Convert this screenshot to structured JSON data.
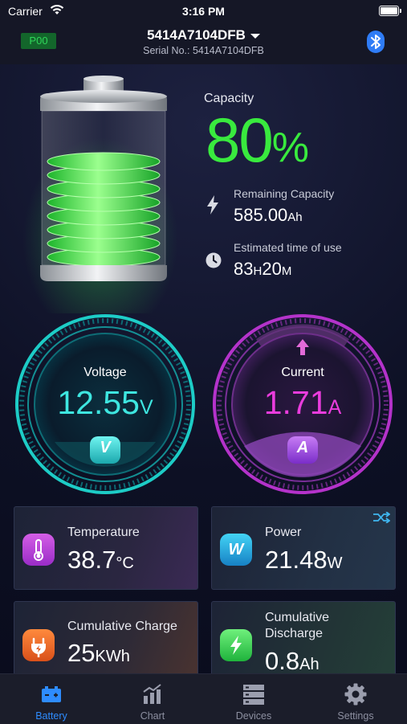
{
  "status_bar": {
    "carrier": "Carrier",
    "time": "3:16 PM"
  },
  "header": {
    "pack_code": "P00",
    "device_name": "5414A7104DFB",
    "serial_label": "Serial No.: 5414A7104DFB"
  },
  "capacity": {
    "label": "Capacity",
    "value": "80",
    "unit": "%",
    "fill_fraction": 0.8,
    "remaining_label": "Remaining Capacity",
    "remaining_value": "585.00",
    "remaining_unit": "Ah",
    "estimated_label": "Estimated time of use",
    "est_hours": "83",
    "est_h_unit": "H",
    "est_minutes": "20",
    "est_m_unit": "M"
  },
  "voltage": {
    "label": "Voltage",
    "value": "12.55",
    "unit": "V",
    "badge": "V"
  },
  "current": {
    "label": "Current",
    "value": "1.71",
    "unit": "A",
    "badge": "A"
  },
  "cards": {
    "temperature": {
      "label": "Temperature",
      "value": "38.7",
      "unit": "°C"
    },
    "power": {
      "label": "Power",
      "value": "21.48",
      "unit": "W",
      "badge": "W"
    },
    "charge": {
      "label": "Cumulative Charge",
      "value": "25",
      "unit": "KWh"
    },
    "discharge": {
      "label_line1": "Cumulative",
      "label_line2": "Discharge",
      "value": "0.8",
      "unit": "Ah"
    }
  },
  "tabs": [
    {
      "label": "Battery"
    },
    {
      "label": "Chart"
    },
    {
      "label": "Devices"
    },
    {
      "label": "Settings"
    }
  ],
  "colors": {
    "accent_green": "#39ea3e",
    "voltage_cyan": "#3ee6e0",
    "current_magenta": "#ea3cdd",
    "active_tab": "#2e8cff",
    "inactive_tab": "#8c8fa0"
  }
}
